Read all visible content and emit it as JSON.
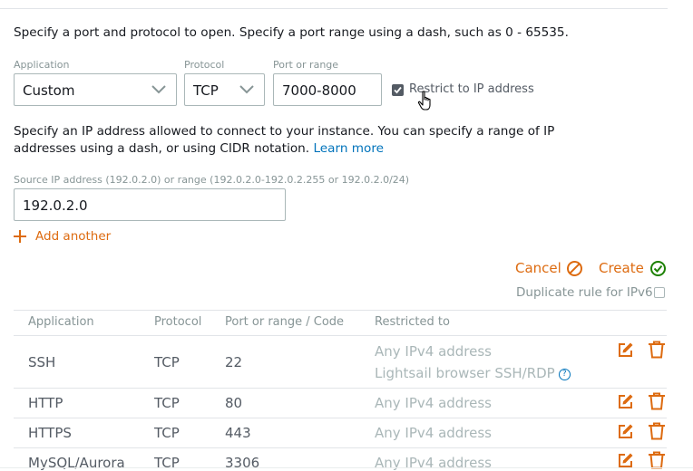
{
  "instructions": "Specify a port and protocol to open. Specify a port range using a dash, such as 0 - 65535.",
  "form": {
    "application_label": "Application",
    "application_value": "Custom",
    "protocol_label": "Protocol",
    "protocol_value": "TCP",
    "port_label": "Port or range",
    "port_value": "7000-8000",
    "restrict_label": "Restrict to IP address",
    "restrict_checked": true
  },
  "ip_description": {
    "line1": "Specify an IP address allowed to connect to your instance. You can specify a range of IP",
    "line2": "addresses using a dash, or using CIDR notation.",
    "learn_more": "Learn more"
  },
  "source": {
    "label": "Source IP address (192.0.2.0) or range (192.0.2.0-192.0.2.255 or 192.0.2.0/24)",
    "value": "192.0.2.0"
  },
  "add_another": "Add another",
  "actions": {
    "cancel": "Cancel",
    "create": "Create",
    "duplicate_ipv6": "Duplicate rule for IPv6"
  },
  "colors": {
    "accent": "#dd6b10",
    "success": "#1d8102",
    "link": "#0073bb"
  },
  "table": {
    "headers": [
      "Application",
      "Protocol",
      "Port or range / Code",
      "Restricted to"
    ],
    "rows": [
      {
        "application": "SSH",
        "protocol": "TCP",
        "port": "22",
        "restricted": "Any IPv4 address",
        "restricted_extra": "Lightsail browser SSH/RDP"
      },
      {
        "application": "HTTP",
        "protocol": "TCP",
        "port": "80",
        "restricted": "Any IPv4 address"
      },
      {
        "application": "HTTPS",
        "protocol": "TCP",
        "port": "443",
        "restricted": "Any IPv4 address"
      },
      {
        "application": "MySQL/Aurora",
        "protocol": "TCP",
        "port": "3306",
        "restricted": "Any IPv4 address"
      }
    ]
  }
}
